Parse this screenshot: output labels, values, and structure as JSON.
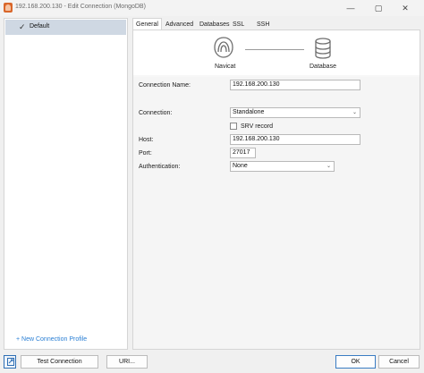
{
  "window": {
    "title": "192.168.200.130 - Edit Connection (MongoDB)",
    "minimize_glyph": "—",
    "maximize_glyph": "▢",
    "close_glyph": "✕"
  },
  "profiles": {
    "items": [
      {
        "label": "Default",
        "selected": true,
        "icon": "check-icon"
      }
    ],
    "new_profile_label": "+ New Connection Profile"
  },
  "tabs": [
    {
      "label": "General",
      "active": true
    },
    {
      "label": "Advanced",
      "active": false
    },
    {
      "label": "Databases",
      "active": false
    },
    {
      "label": "SSL",
      "active": false
    },
    {
      "label": "SSH",
      "active": false
    }
  ],
  "diagram": {
    "source_label": "Navicat",
    "source_icon": "navicat-icon",
    "target_label": "Database",
    "target_icon": "database-icon"
  },
  "form": {
    "connection_name": {
      "label": "Connection Name:",
      "value": "192.168.200.130"
    },
    "connection": {
      "label": "Connection:",
      "value": "Standalone"
    },
    "srv_record": {
      "label": "SRV record",
      "checked": false
    },
    "host": {
      "label": "Host:",
      "value": "192.168.200.130"
    },
    "port": {
      "label": "Port:",
      "value": "27017"
    },
    "authentication": {
      "label": "Authentication:",
      "value": "None"
    }
  },
  "buttons": {
    "test_connection": "Test Connection",
    "uri": "URI...",
    "ok": "OK",
    "cancel": "Cancel",
    "settings_icon": "link-icon"
  },
  "colors": {
    "selection": "#cfd8e3",
    "link": "#2a7fd4",
    "primary_border": "#3a7cc3",
    "app_icon": "#d9662a"
  }
}
